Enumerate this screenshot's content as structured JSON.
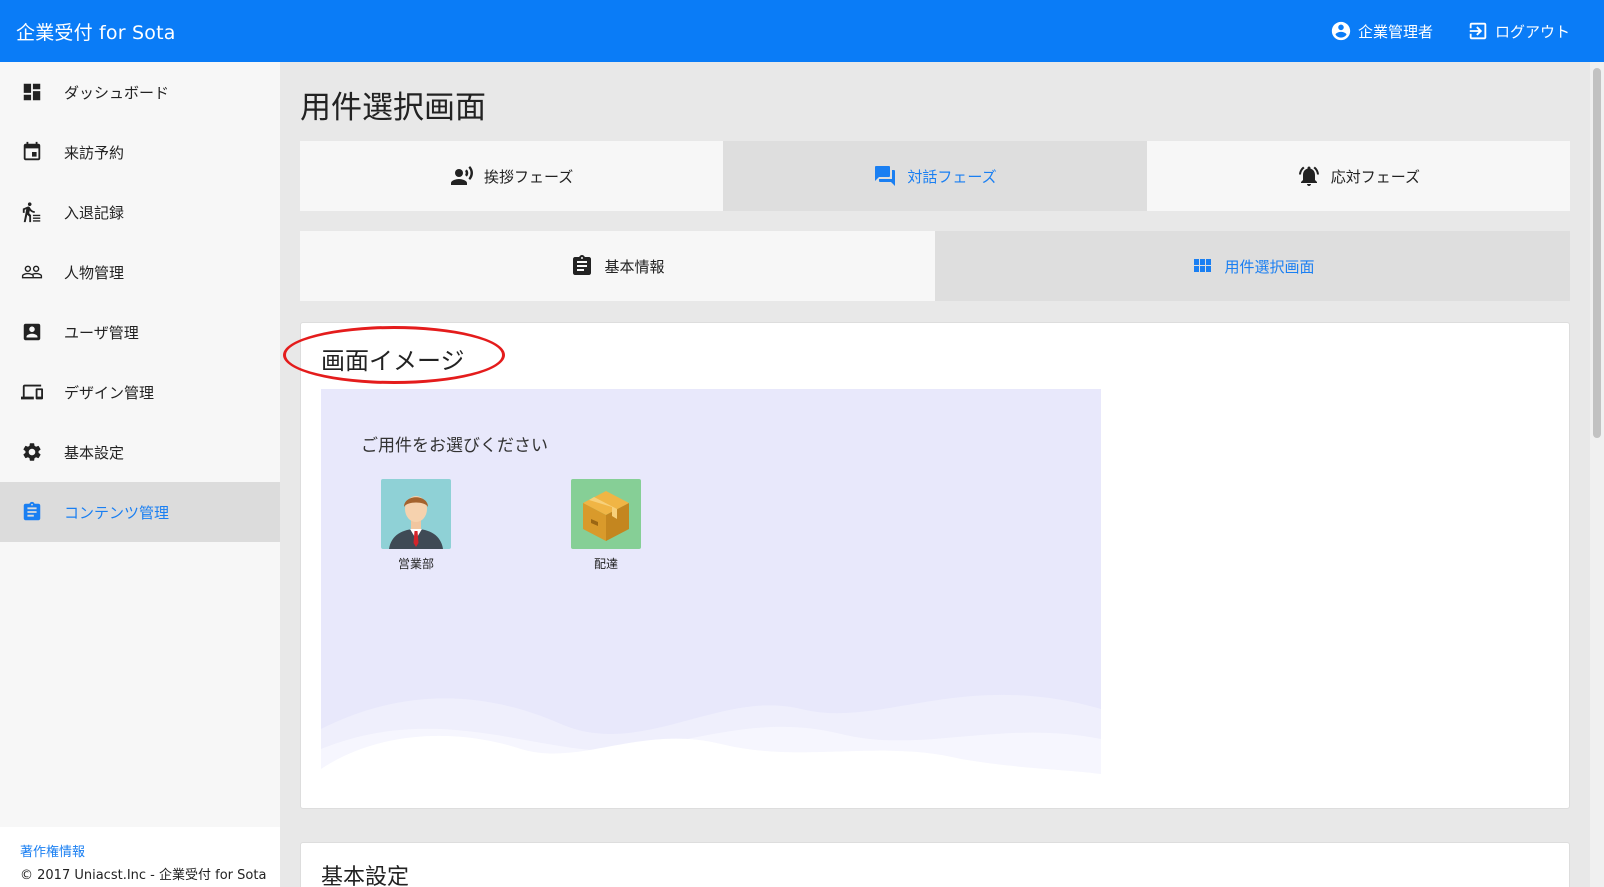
{
  "header": {
    "brand": "企業受付 for Sota",
    "user_label": "企業管理者",
    "logout_label": "ログアウト",
    "color": "#0a7cf7"
  },
  "sidebar": {
    "items": [
      {
        "label": "ダッシュボード",
        "icon": "dashboard-icon"
      },
      {
        "label": "来訪予約",
        "icon": "calendar-icon"
      },
      {
        "label": "入退記録",
        "icon": "walk-icon"
      },
      {
        "label": "人物管理",
        "icon": "people-icon"
      },
      {
        "label": "ユーザ管理",
        "icon": "account-box-icon"
      },
      {
        "label": "デザイン管理",
        "icon": "devices-icon"
      },
      {
        "label": "基本設定",
        "icon": "gear-icon"
      },
      {
        "label": "コンテンツ管理",
        "icon": "clipboard-icon",
        "active": true
      }
    ],
    "footer": {
      "link": "著作権情報",
      "copyright": "© 2017 Uniacst.Inc - 企業受付 for Sota"
    }
  },
  "main": {
    "title": "用件選択画面",
    "phase_tabs": [
      {
        "label": "挨拶フェーズ",
        "icon": "voice-person-icon"
      },
      {
        "label": "対話フェーズ",
        "icon": "chat-icon",
        "selected": true
      },
      {
        "label": "応対フェーズ",
        "icon": "bell-icon"
      }
    ],
    "sub_tabs": [
      {
        "label": "基本情報",
        "icon": "clipboard-icon"
      },
      {
        "label": "用件選択画面",
        "icon": "grid-icon",
        "selected": true
      }
    ],
    "image_card": {
      "title": "画面イメージ",
      "prompt": "ご用件をお選びください",
      "choices": [
        {
          "label": "営業部",
          "icon": "businessman-icon"
        },
        {
          "label": "配達",
          "icon": "package-icon"
        }
      ]
    },
    "next_card": {
      "title": "基本設定"
    }
  },
  "accent_color": "#1a7ff2",
  "annotation_color": "#e41c1c"
}
